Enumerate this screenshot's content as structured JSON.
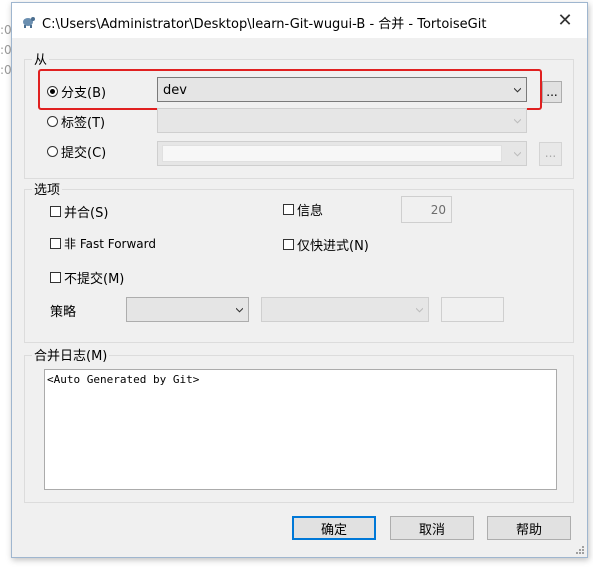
{
  "background": {
    "fragments": [
      ":0",
      ":0",
      ":0"
    ]
  },
  "window": {
    "title": "C:\\Users\\Administrator\\Desktop\\learn-Git-wugui-B - 合并 - TortoiseGit",
    "close_glyph": "✕"
  },
  "from": {
    "legend": "从",
    "branch": {
      "label": "分支(B)",
      "value": "dev",
      "selected": true
    },
    "tag": {
      "label": "标签(T)",
      "value": "",
      "selected": false
    },
    "commit": {
      "label": "提交(C)",
      "value": "",
      "selected": false
    },
    "browse_label": "..."
  },
  "options": {
    "legend": "选项",
    "squash": "并合(S)",
    "message": "信息",
    "log_count": "20",
    "no_ff": "非 Fast Forward",
    "ff_only": "仅快进式(N)",
    "no_commit": "不提交(M)",
    "strategy_label": "策略"
  },
  "merge_log": {
    "legend": "合并日志(M)",
    "text": "<Auto Generated by Git>"
  },
  "buttons": {
    "ok": "确定",
    "cancel": "取消",
    "help": "帮助"
  },
  "colors": {
    "highlight": "#e02020",
    "default_button_border": "#0078d7"
  }
}
